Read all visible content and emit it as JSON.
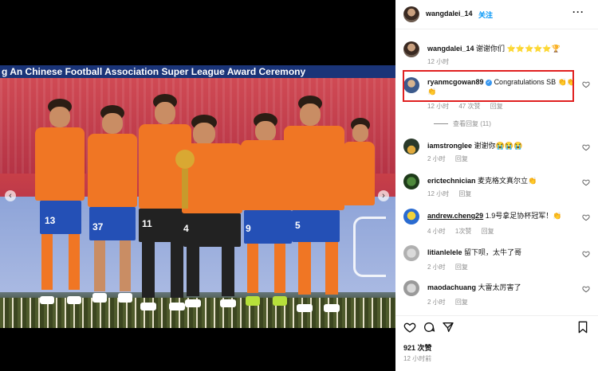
{
  "photo": {
    "banner_text": "g An Chinese Football Association Super League Award Ceremony",
    "players": [
      {
        "number": "13"
      },
      {
        "number": "37"
      },
      {
        "number": "11"
      },
      {
        "number": "4"
      },
      {
        "number": "9"
      },
      {
        "number": "5"
      }
    ],
    "prev_arrow": "‹",
    "next_arrow": "›"
  },
  "post": {
    "author": "wangdalei_14",
    "follow_label": "关注",
    "more_label": "···",
    "likes": "921 次赞",
    "time_ago": "12 小时前"
  },
  "comments": [
    {
      "user": "wangdalei_14",
      "text": "谢谢你们 ⭐⭐⭐⭐⭐🏆",
      "meta": [
        "12 小时"
      ]
    },
    {
      "user": "ryanmcgowan89",
      "verified": true,
      "text": "Congratulations SB 👏👏",
      "text2": "👏",
      "meta": [
        "12 小时",
        "47 次赞",
        "回复"
      ],
      "view_replies": "查看回复 (11)"
    },
    {
      "user": "iamstronglee",
      "text": "谢谢你😭😭😭",
      "meta": [
        "2 小时",
        "回复"
      ]
    },
    {
      "user": "erictechnician",
      "text": "麦克格文真尔立👏",
      "meta": [
        "12 小时",
        "回复"
      ]
    },
    {
      "user": "andrew.cheng29",
      "text": "1.9号拿足协杯冠军！👏",
      "meta": [
        "4 小时",
        "1次赞",
        "回复"
      ]
    },
    {
      "user": "litianlelele",
      "text": "留下呗，太牛了哥",
      "meta": [
        "2 小时",
        "回复"
      ]
    },
    {
      "user": "maodachuang",
      "text": "大雷太厉害了",
      "meta": [
        "2 小时",
        "回复"
      ]
    }
  ],
  "icons": {
    "heart": "heart-icon",
    "comment": "comment-icon",
    "share": "share-icon",
    "bookmark": "bookmark-icon"
  },
  "colors": {
    "accent": "#0095f6",
    "highlight": "#e02020",
    "jersey": "#f07624"
  }
}
